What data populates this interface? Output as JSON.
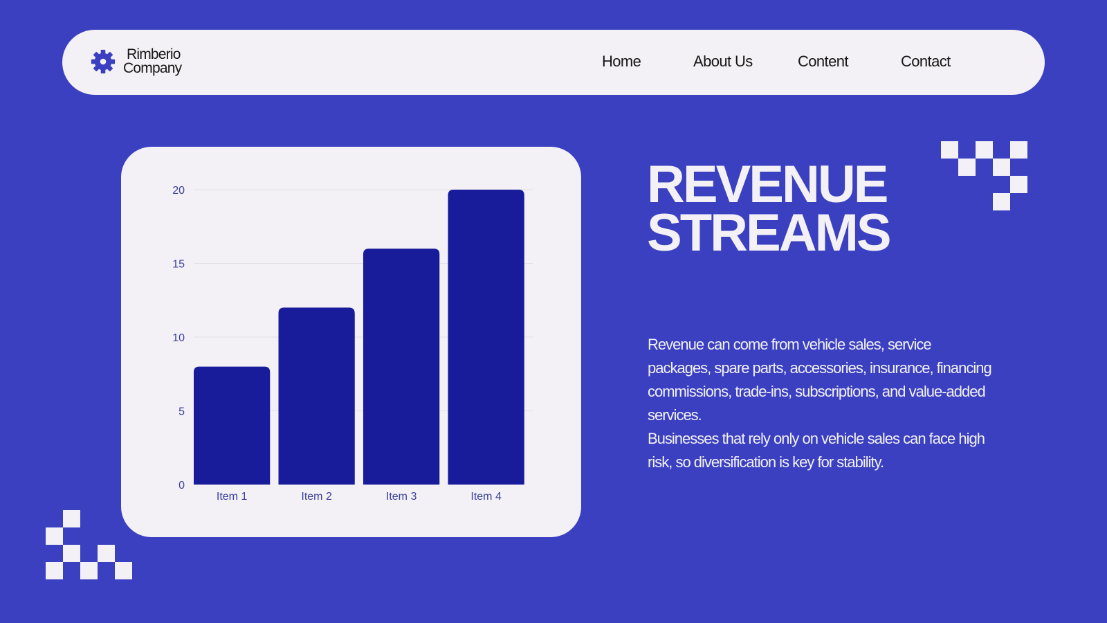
{
  "brand": {
    "line1": "Rimberio",
    "line2": "Company"
  },
  "nav": {
    "items": [
      {
        "label": "Home"
      },
      {
        "label": "About Us"
      },
      {
        "label": "Content"
      },
      {
        "label": "Contact"
      }
    ]
  },
  "heading": {
    "line1": "REVENUE",
    "line2": "STREAMS"
  },
  "body": {
    "paragraph1": "Revenue can come from vehicle sales, service packages, spare parts, accessories, insurance, financing commissions, trade-ins, subscriptions, and value-added services.",
    "paragraph2": "Businesses that rely only on vehicle sales can face high risk, so diversification is key for stability."
  },
  "colors": {
    "background": "#3b40c1",
    "card": "#f3f1f5",
    "bar": "#181b9a",
    "axis_text": "#3a3d9e",
    "grid": "#e0dfe6"
  },
  "icons": {
    "logo": "gear-icon"
  },
  "chart_data": {
    "type": "bar",
    "categories": [
      "Item 1",
      "Item 2",
      "Item 3",
      "Item 4"
    ],
    "values": [
      8,
      12,
      16,
      20
    ],
    "ylim": [
      0,
      20
    ],
    "yticks": [
      0,
      5,
      10,
      15,
      20
    ],
    "title": "",
    "xlabel": "",
    "ylabel": "",
    "grid": true,
    "legend": "none"
  }
}
